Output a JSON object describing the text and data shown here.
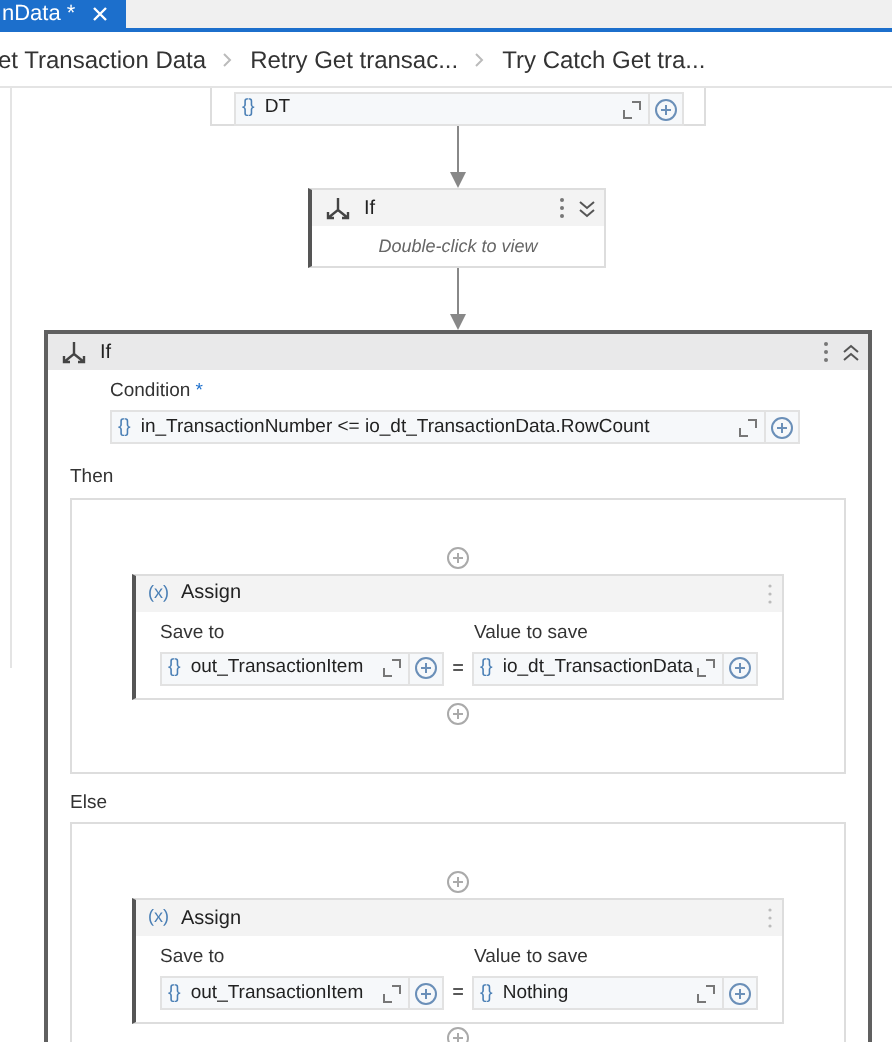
{
  "tab": {
    "title": "nData *"
  },
  "breadcrumbs": [
    "et Transaction Data",
    "Retry Get transac...",
    "Try Catch Get tra..."
  ],
  "top_activity": {
    "field": {
      "prefix": "{}",
      "value": "DT"
    }
  },
  "collapsed_if": {
    "title": "If",
    "hint": "Double-click to view"
  },
  "if_activity": {
    "title": "If",
    "condition_label": "Condition",
    "required_mark": "*",
    "condition": {
      "prefix": "{}",
      "value": "in_TransactionNumber <= io_dt_TransactionData.RowCount"
    },
    "branches": [
      {
        "label": "Then",
        "assign": {
          "icon": "(x)",
          "title": "Assign",
          "save_to_label": "Save to",
          "value_label": "Value to save",
          "operator": "=",
          "save_to": {
            "prefix": "{}",
            "value": "out_TransactionItem"
          },
          "value": {
            "prefix": "{}",
            "value": "io_dt_TransactionData"
          }
        }
      },
      {
        "label": "Else",
        "assign": {
          "icon": "(x)",
          "title": "Assign",
          "save_to_label": "Save to",
          "value_label": "Value to save",
          "operator": "=",
          "save_to": {
            "prefix": "{}",
            "value": "out_TransactionItem"
          },
          "value": {
            "prefix": "{}",
            "value": "Nothing"
          }
        }
      }
    ]
  }
}
